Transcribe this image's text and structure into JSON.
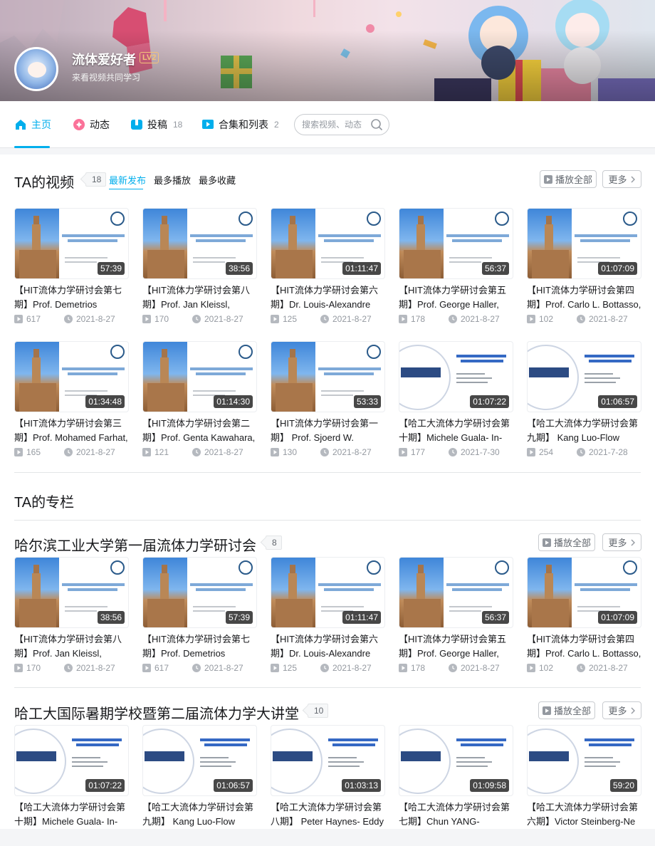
{
  "user": {
    "name": "流体爱好者",
    "level": "LV2",
    "sign": "来看视频共同学习"
  },
  "nav": {
    "home": "主页",
    "dynamic": "动态",
    "posts": "投稿",
    "posts_count": "18",
    "collections": "合集和列表",
    "collections_count": "2",
    "search_placeholder": "搜索视频、动态"
  },
  "videos_section": {
    "title": "TA的视频",
    "count": "18",
    "sort_tabs": [
      "最新发布",
      "最多播放",
      "最多收藏"
    ],
    "play_all": "播放全部",
    "more": "更多",
    "rows": [
      [
        {
          "title": "【HIT流体力学研讨会第七期】Prof. Demetrios",
          "duration": "57:39",
          "plays": "617",
          "date": "2021-8-27",
          "thumb": "hit"
        },
        {
          "title": "【HIT流体力学研讨会第八期】Prof. Jan Kleissl,",
          "duration": "38:56",
          "plays": "170",
          "date": "2021-8-27",
          "thumb": "hit"
        },
        {
          "title": "【HIT流体力学研讨会第六期】Dr. Louis-Alexandre",
          "duration": "01:11:47",
          "plays": "125",
          "date": "2021-8-27",
          "thumb": "hit"
        },
        {
          "title": "【HIT流体力学研讨会第五期】Prof. George Haller,",
          "duration": "56:37",
          "plays": "178",
          "date": "2021-8-27",
          "thumb": "hit"
        },
        {
          "title": "【HIT流体力学研讨会第四期】Prof. Carlo L. Bottasso,",
          "duration": "01:07:09",
          "plays": "102",
          "date": "2021-8-27",
          "thumb": "hit"
        }
      ],
      [
        {
          "title": "【HIT流体力学研讨会第三期】Prof. Mohamed Farhat,",
          "duration": "01:34:48",
          "plays": "165",
          "date": "2021-8-27",
          "thumb": "hit"
        },
        {
          "title": "【HIT流体力学研讨会第二期】Prof. Genta Kawahara,",
          "duration": "01:14:30",
          "plays": "121",
          "date": "2021-8-27",
          "thumb": "hit"
        },
        {
          "title": "【HIT流体力学研讨会第一期】 Prof. Sjoerd W.",
          "duration": "53:33",
          "plays": "130",
          "date": "2021-8-27",
          "thumb": "hit"
        },
        {
          "title": "【哈工大流体力学研讨会第十期】Michele Guala- In-",
          "duration": "01:07:22",
          "plays": "177",
          "date": "2021-7-30",
          "thumb": "hgd"
        },
        {
          "title": "【哈工大流体力学研讨会第九期】 Kang Luo-Flow",
          "duration": "01:06:57",
          "plays": "254",
          "date": "2021-7-28",
          "thumb": "hgd"
        }
      ]
    ]
  },
  "column_section": {
    "title": "TA的专栏"
  },
  "collection1": {
    "title": "哈尔滨工业大学第一届流体力学研讨会",
    "count": "8",
    "play_all": "播放全部",
    "more": "更多",
    "items": [
      {
        "title": "【HIT流体力学研讨会第八期】Prof. Jan Kleissl,",
        "duration": "38:56",
        "plays": "170",
        "date": "2021-8-27",
        "thumb": "hit"
      },
      {
        "title": "【HIT流体力学研讨会第七期】Prof. Demetrios",
        "duration": "57:39",
        "plays": "617",
        "date": "2021-8-27",
        "thumb": "hit"
      },
      {
        "title": "【HIT流体力学研讨会第六期】Dr. Louis-Alexandre",
        "duration": "01:11:47",
        "plays": "125",
        "date": "2021-8-27",
        "thumb": "hit"
      },
      {
        "title": "【HIT流体力学研讨会第五期】Prof. George Haller,",
        "duration": "56:37",
        "plays": "178",
        "date": "2021-8-27",
        "thumb": "hit"
      },
      {
        "title": "【HIT流体力学研讨会第四期】Prof. Carlo L. Bottasso,",
        "duration": "01:07:09",
        "plays": "102",
        "date": "2021-8-27",
        "thumb": "hit"
      }
    ]
  },
  "collection2": {
    "title": "哈工大国际暑期学校暨第二届流体力学大讲堂",
    "count": "10",
    "play_all": "播放全部",
    "more": "更多",
    "items": [
      {
        "title": "【哈工大流体力学研讨会第十期】Michele Guala- In-",
        "duration": "01:07:22",
        "thumb": "hgd"
      },
      {
        "title": "【哈工大流体力学研讨会第九期】 Kang Luo-Flow",
        "duration": "01:06:57",
        "thumb": "hgd"
      },
      {
        "title": "【哈工大流体力学研讨会第八期】 Peter Haynes- Eddy-",
        "duration": "01:03:13",
        "thumb": "hgd"
      },
      {
        "title": "【哈工大流体力学研讨会第七期】Chun YANG-",
        "duration": "01:09:58",
        "thumb": "hgd"
      },
      {
        "title": "【哈工大流体力学研讨会第六期】Victor Steinberg-New",
        "duration": "59:20",
        "thumb": "hgd"
      }
    ]
  },
  "colors": {
    "accent": "#00aeec",
    "text": "#18191c",
    "muted": "#9499a0",
    "level": "#f3c37b"
  }
}
